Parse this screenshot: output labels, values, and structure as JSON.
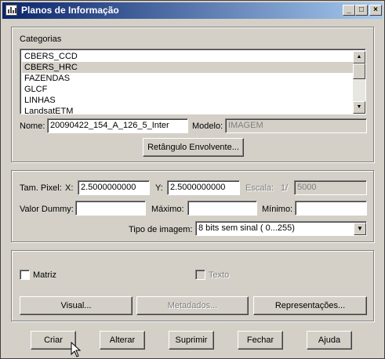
{
  "window": {
    "title": "Planos de Informação"
  },
  "title_buttons": {
    "minimize": "_",
    "maximize": "□",
    "close": "×"
  },
  "categorias": {
    "label": "Categorias",
    "items": [
      "CBERS_CCD",
      "CBERS_HRC",
      "FAZENDAS",
      "GLCF",
      "LINHAS",
      "LandsatETM"
    ],
    "selected": "CBERS_HRC"
  },
  "nome": {
    "label": "Nome:",
    "value": "20090422_154_A_126_5_Inter"
  },
  "modelo": {
    "label": "Modelo:",
    "value": "IMAGEM"
  },
  "retangulo_button": "Retângulo Envolvente...",
  "pixel": {
    "label": "Tam. Pixel:",
    "x_label": "X:",
    "x_value": "2.5000000000",
    "y_label": "Y:",
    "y_value": "2.5000000000",
    "escala_label": "Escala:",
    "escala_prefix": "1/",
    "escala_value": "5000"
  },
  "valores": {
    "dummy_label": "Valor Dummy:",
    "dummy_value": "",
    "maximo_label": "Máximo:",
    "maximo_value": "",
    "minimo_label": "Mínimo:",
    "minimo_value": ""
  },
  "tipo_imagem": {
    "label": "Tipo de imagem:",
    "selected": "8 bits sem sinal ( 0...255)"
  },
  "checks": {
    "matriz_label": "Matriz",
    "matriz_checked": false,
    "texto_label": "Texto",
    "texto_checked": false
  },
  "group_buttons": {
    "visual": "Visual...",
    "metadados": "Metadados...",
    "representacoes": "Representações..."
  },
  "bottom_buttons": {
    "criar": "Criar",
    "alterar": "Alterar",
    "suprimir": "Suprimir",
    "fechar": "Fechar",
    "ajuda": "Ajuda"
  },
  "icons": {
    "scroll_up": "▲",
    "scroll_down": "▼",
    "combo": "▼"
  }
}
